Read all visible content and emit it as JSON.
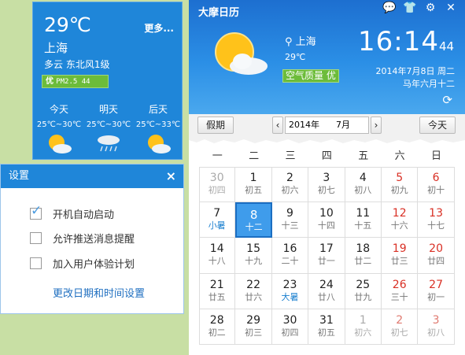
{
  "weather_widget": {
    "temp": "29℃",
    "more_label": "更多...",
    "city": "上海",
    "condition": "多云  东北风1级",
    "aqi_label": "优",
    "aqi_value": "PM2.5 44",
    "forecast": [
      {
        "day": "今天",
        "range": "25℃~30℃",
        "icon": "sunny-cloud-icon"
      },
      {
        "day": "明天",
        "range": "25℃~30℃",
        "icon": "rain-cloud-icon"
      },
      {
        "day": "后天",
        "range": "25℃~33℃",
        "icon": "sunny-cloud-icon"
      }
    ]
  },
  "settings": {
    "title": "设置",
    "close": "×",
    "options": [
      {
        "label": "开机自动启动",
        "checked": true
      },
      {
        "label": "允许推送消息提醒",
        "checked": false
      },
      {
        "label": "加入用户体验计划",
        "checked": false
      }
    ],
    "link": "更改日期和时间设置"
  },
  "calendar": {
    "title": "大摩日历",
    "header_icons": [
      "chat-icon",
      "shirt-icon",
      "gear-icon",
      "close-icon"
    ],
    "city": "上海",
    "temp": "29℃",
    "air_quality": "空气质量 优",
    "time": "16:14",
    "seconds": "44",
    "date": "2014年7月8日  周二",
    "lunar": "马年六月十二",
    "holiday_button": "假期",
    "prev": "‹",
    "next": "›",
    "year": "2014年",
    "month": "7月",
    "today_button": "今天",
    "weekdays": [
      "一",
      "二",
      "三",
      "四",
      "五",
      "六",
      "日"
    ],
    "days": [
      {
        "n": "30",
        "l": "初四",
        "other": true
      },
      {
        "n": "1",
        "l": "初五"
      },
      {
        "n": "2",
        "l": "初六"
      },
      {
        "n": "3",
        "l": "初七"
      },
      {
        "n": "4",
        "l": "初八"
      },
      {
        "n": "5",
        "l": "初九"
      },
      {
        "n": "6",
        "l": "初十"
      },
      {
        "n": "7",
        "l": "小暑",
        "term": true
      },
      {
        "n": "8",
        "l": "十二",
        "today": true
      },
      {
        "n": "9",
        "l": "十三"
      },
      {
        "n": "10",
        "l": "十四"
      },
      {
        "n": "11",
        "l": "十五"
      },
      {
        "n": "12",
        "l": "十六"
      },
      {
        "n": "13",
        "l": "十七"
      },
      {
        "n": "14",
        "l": "十八"
      },
      {
        "n": "15",
        "l": "十九"
      },
      {
        "n": "16",
        "l": "二十"
      },
      {
        "n": "17",
        "l": "廿一"
      },
      {
        "n": "18",
        "l": "廿二"
      },
      {
        "n": "19",
        "l": "廿三"
      },
      {
        "n": "20",
        "l": "廿四"
      },
      {
        "n": "21",
        "l": "廿五"
      },
      {
        "n": "22",
        "l": "廿六"
      },
      {
        "n": "23",
        "l": "大暑",
        "term": true
      },
      {
        "n": "24",
        "l": "廿八"
      },
      {
        "n": "25",
        "l": "廿九"
      },
      {
        "n": "26",
        "l": "三十"
      },
      {
        "n": "27",
        "l": "初一"
      },
      {
        "n": "28",
        "l": "初二"
      },
      {
        "n": "29",
        "l": "初三"
      },
      {
        "n": "30",
        "l": "初四"
      },
      {
        "n": "31",
        "l": "初五"
      },
      {
        "n": "1",
        "l": "初六",
        "other": true
      },
      {
        "n": "2",
        "l": "初七",
        "other": true
      },
      {
        "n": "3",
        "l": "初八",
        "other": true
      }
    ]
  },
  "colors": {
    "accent": "#1f86d9",
    "today": "#3f9ceb",
    "weekend": "#d93025",
    "aqi": "#6cbc3a"
  }
}
